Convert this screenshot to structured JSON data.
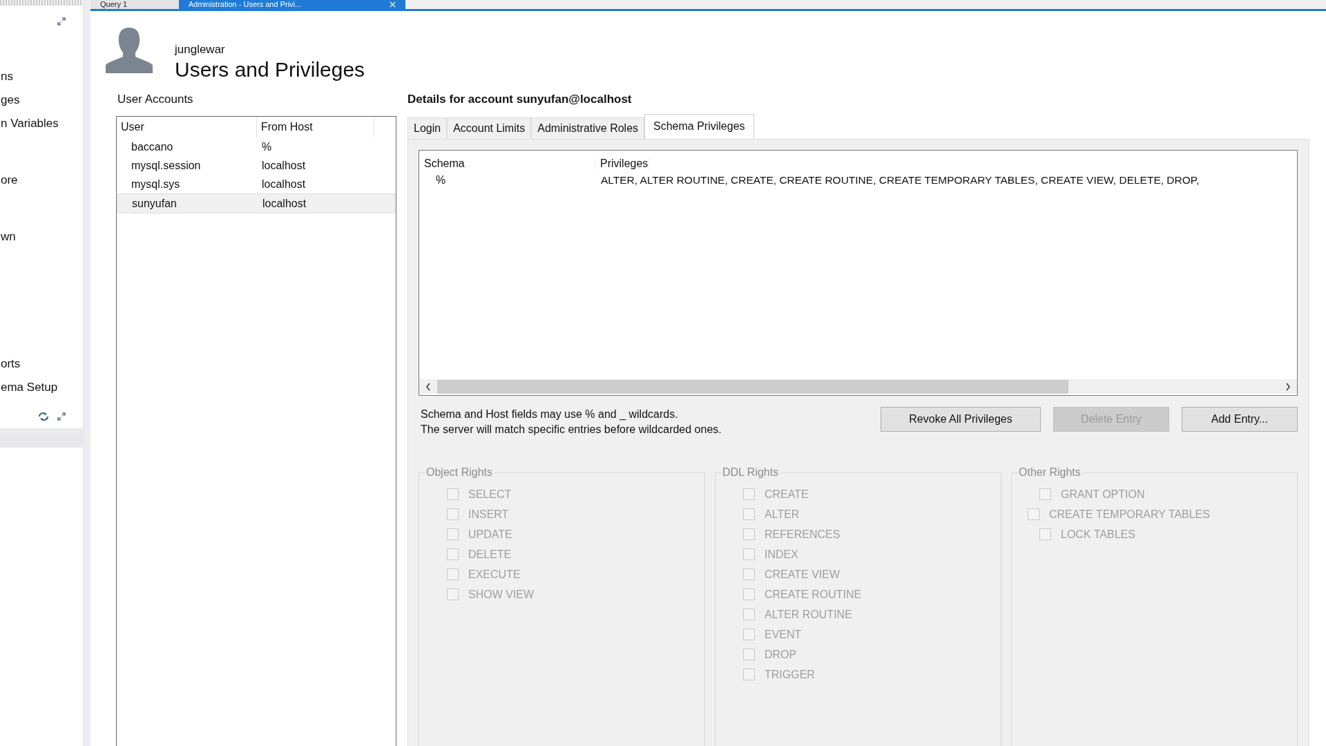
{
  "doc_tabs": [
    {
      "label": "Query 1",
      "selected": false
    },
    {
      "label": "Administration - Users and Privi...",
      "selected": true
    }
  ],
  "sidebar": {
    "items": [
      {
        "label": "ns"
      },
      {
        "label": "ges"
      },
      {
        "label": "n Variables"
      },
      {
        "label": "ore"
      },
      {
        "label": "wn"
      },
      {
        "label": "orts"
      },
      {
        "label": "ema Setup"
      }
    ]
  },
  "header": {
    "connection": "junglewar",
    "title": "Users and Privileges"
  },
  "accounts": {
    "title": "User Accounts",
    "columns": [
      "User",
      "From Host"
    ],
    "rows": [
      {
        "user": "baccano",
        "host": "%",
        "selected": false
      },
      {
        "user": "mysql.session",
        "host": "localhost",
        "selected": false
      },
      {
        "user": "mysql.sys",
        "host": "localhost",
        "selected": false
      },
      {
        "user": "sunyufan",
        "host": "localhost",
        "selected": true
      }
    ]
  },
  "details": {
    "title": "Details for account sunyufan@localhost",
    "tabs": [
      {
        "label": "Login",
        "selected": false
      },
      {
        "label": "Account Limits",
        "selected": false
      },
      {
        "label": "Administrative Roles",
        "selected": false
      },
      {
        "label": "Schema Privileges",
        "selected": true
      }
    ],
    "table": {
      "columns": [
        "Schema",
        "Privileges"
      ],
      "rows": [
        {
          "schema": "%",
          "privileges": "ALTER, ALTER ROUTINE, CREATE, CREATE ROUTINE, CREATE TEMPORARY TABLES, CREATE VIEW, DELETE, DROP,"
        }
      ]
    },
    "note": [
      "Schema and Host fields may use % and _ wildcards.",
      "The server will match specific entries before wildcarded ones."
    ],
    "buttons": [
      {
        "label": "Revoke All Privileges",
        "disabled": false
      },
      {
        "label": "Delete Entry",
        "disabled": true
      },
      {
        "label": "Add Entry...",
        "disabled": false
      }
    ],
    "groups": [
      {
        "title": "Object Rights",
        "items": [
          {
            "label": "SELECT",
            "checked": false,
            "disabled": true
          },
          {
            "label": "INSERT",
            "checked": false,
            "disabled": true
          },
          {
            "label": "UPDATE",
            "checked": false,
            "disabled": true
          },
          {
            "label": "DELETE",
            "checked": false,
            "disabled": true
          },
          {
            "label": "EXECUTE",
            "checked": false,
            "disabled": true
          },
          {
            "label": "SHOW VIEW",
            "checked": false,
            "disabled": true
          }
        ]
      },
      {
        "title": "DDL Rights",
        "items": [
          {
            "label": "CREATE",
            "checked": false,
            "disabled": true
          },
          {
            "label": "ALTER",
            "checked": false,
            "disabled": true
          },
          {
            "label": "REFERENCES",
            "checked": false,
            "disabled": true
          },
          {
            "label": "INDEX",
            "checked": false,
            "disabled": true
          },
          {
            "label": "CREATE VIEW",
            "checked": false,
            "disabled": true
          },
          {
            "label": "CREATE ROUTINE",
            "checked": false,
            "disabled": true
          },
          {
            "label": "ALTER ROUTINE",
            "checked": false,
            "disabled": true
          },
          {
            "label": "EVENT",
            "checked": false,
            "disabled": true
          },
          {
            "label": "DROP",
            "checked": false,
            "disabled": true
          },
          {
            "label": "TRIGGER",
            "checked": false,
            "disabled": true
          }
        ]
      },
      {
        "title": "Other Rights",
        "items": [
          {
            "label": "GRANT OPTION",
            "checked": false,
            "disabled": true
          },
          {
            "label": "CREATE TEMPORARY TABLES",
            "checked": false,
            "disabled": true
          },
          {
            "label": "LOCK TABLES",
            "checked": false,
            "disabled": true
          }
        ]
      }
    ]
  }
}
